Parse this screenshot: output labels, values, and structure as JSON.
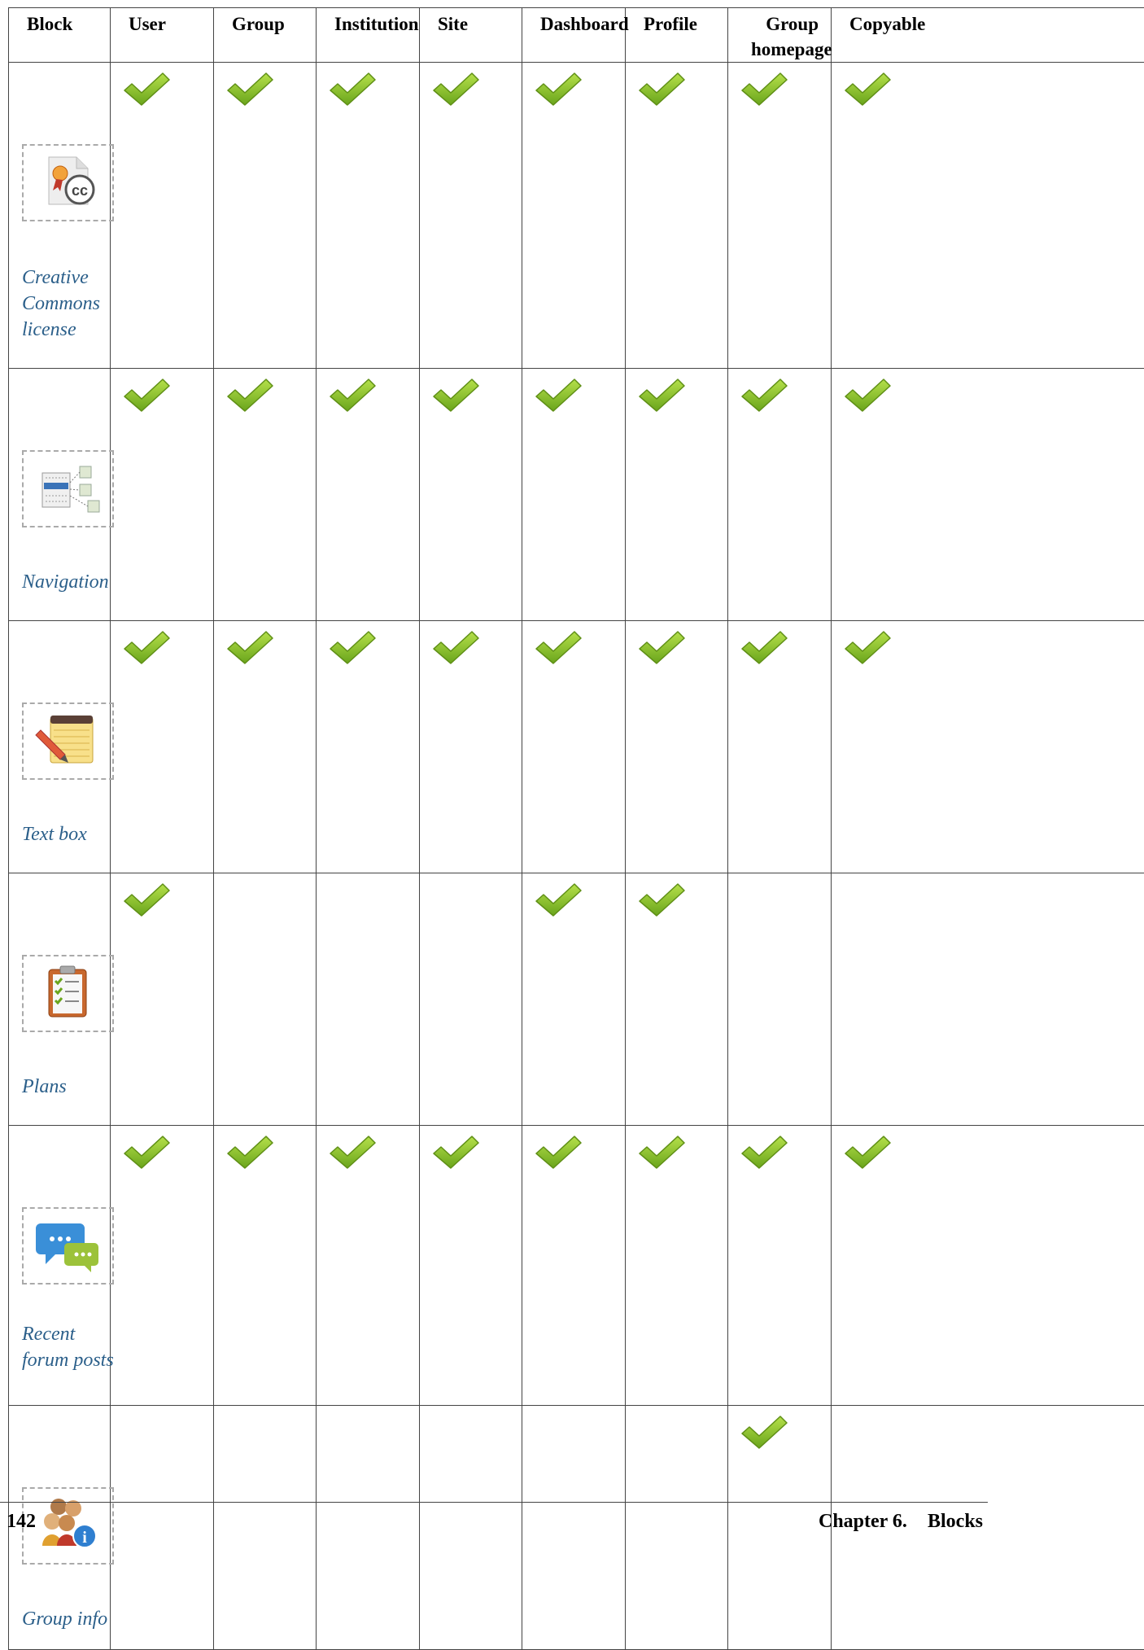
{
  "table": {
    "headers": [
      "Block",
      "User",
      "Group",
      "Institution",
      "Site",
      "Dashboard",
      "Profile",
      "Group homepage",
      "Copyable"
    ],
    "header_group_homepage_line1": "Group",
    "header_group_homepage_line2": "homepage",
    "rows": [
      {
        "name_lines": [
          "Creative",
          "Commons",
          "license"
        ],
        "icon": "creative-commons-license-icon",
        "checks": [
          true,
          true,
          true,
          true,
          true,
          true,
          true,
          true
        ]
      },
      {
        "name_lines": [
          "Navigation"
        ],
        "icon": "navigation-icon",
        "checks": [
          true,
          true,
          true,
          true,
          true,
          true,
          true,
          true
        ]
      },
      {
        "name_lines": [
          "Text box"
        ],
        "icon": "text-box-icon",
        "checks": [
          true,
          true,
          true,
          true,
          true,
          true,
          true,
          true
        ]
      },
      {
        "name_lines": [
          "Plans"
        ],
        "icon": "plans-icon",
        "checks": [
          true,
          false,
          false,
          false,
          true,
          true,
          false,
          false
        ]
      },
      {
        "name_lines": [
          "Recent",
          "forum posts"
        ],
        "icon": "recent-forum-posts-icon",
        "checks": [
          true,
          true,
          true,
          true,
          true,
          true,
          true,
          true
        ]
      },
      {
        "name_lines": [
          "Group info"
        ],
        "icon": "group-info-icon",
        "checks": [
          false,
          false,
          false,
          false,
          false,
          false,
          true,
          false
        ]
      }
    ]
  },
  "footer": {
    "page_number": "142",
    "chapter": "Chapter 6.",
    "title": "Blocks"
  },
  "colors": {
    "check_green": "#8cc63f",
    "link_blue": "#2b5f8a",
    "border": "#444444"
  }
}
